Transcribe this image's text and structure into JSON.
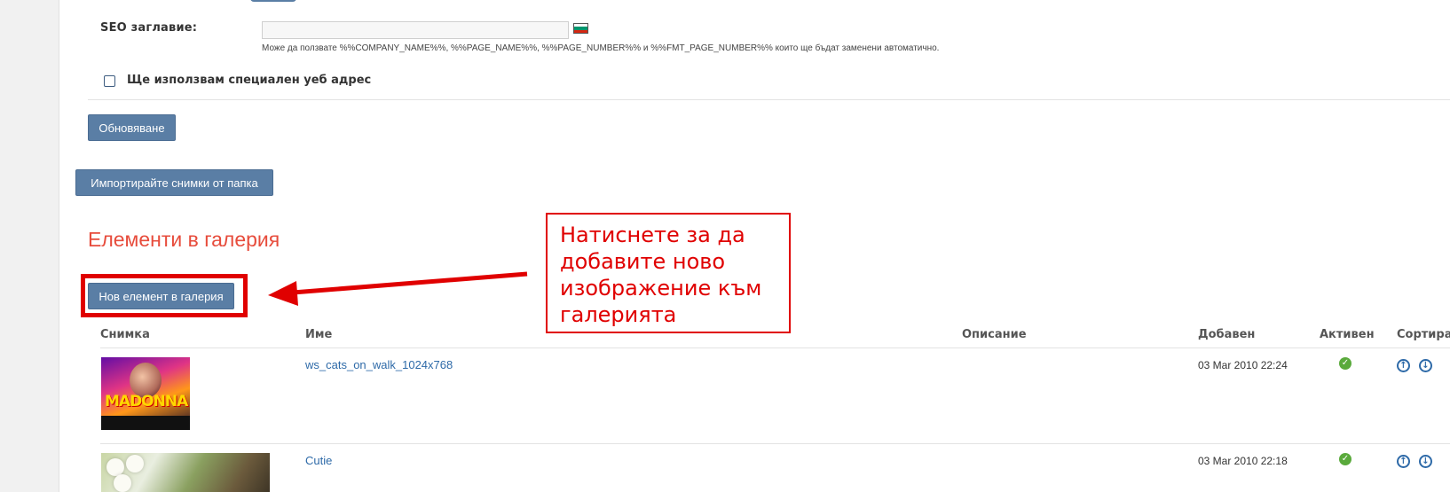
{
  "seo": {
    "label": "SEO заглавие:",
    "value": "",
    "hint": "Може да ползвате %%COMPANY_NAME%%, %%PAGE_NAME%%, %%PAGE_NUMBER%% и %%FMT_PAGE_NUMBER%% които ще бъдат заменени автоматично."
  },
  "custom_url": {
    "label": "Ще използвам специален уеб адрес",
    "checked": false
  },
  "buttons": {
    "update": "Обновяване",
    "import": "Импортирайте снимки от папка",
    "new_item": "Нов елемент в галерия"
  },
  "section_title": "Елементи в галерия",
  "annotation": {
    "lines": [
      "Натиснете за да",
      "добавите ново",
      "изображение към",
      "галерията"
    ],
    "color": "#e00000"
  },
  "table": {
    "headers": {
      "image": "Снимка",
      "name": "Име",
      "description": "Описание",
      "added": "Добавен",
      "active": "Активен",
      "sort": "Сортира"
    },
    "rows": [
      {
        "name": "ws_cats_on_walk_1024x768",
        "description": "",
        "added": "03 Mar 2010 22:24",
        "active": true,
        "thumb_text": "MADONNA"
      },
      {
        "name": "Cutie",
        "description": "",
        "added": "03 Mar 2010 22:18",
        "active": true
      }
    ]
  },
  "icons": {
    "flag": "bulgarian-flag-icon",
    "active": "check-circle-icon",
    "sort_up": "arrow-up-circle-icon",
    "sort_down": "arrow-down-circle-icon"
  },
  "colors": {
    "button": "#5a7ea5",
    "section_title": "#e74c3c",
    "link": "#2e6aa8",
    "active": "#5aaa3c"
  }
}
